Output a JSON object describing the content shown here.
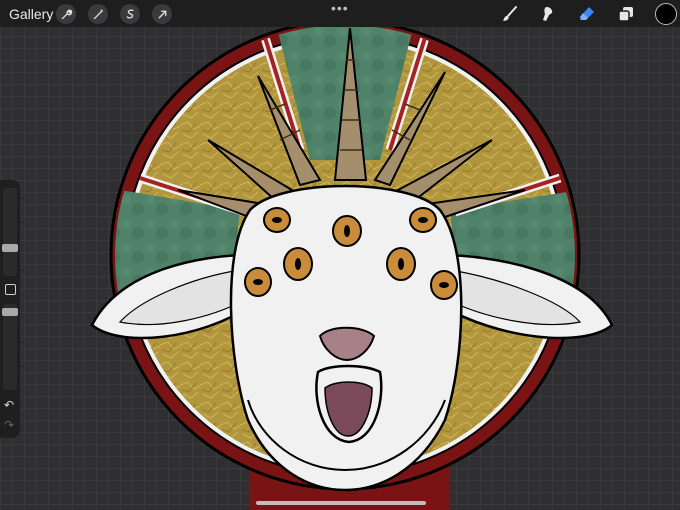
{
  "topbar": {
    "gallery_label": "Gallery",
    "left_tools": [
      "wrench-icon",
      "magic-wand-icon",
      "selection-icon",
      "transform-arrow-icon"
    ],
    "more_dots": "•••",
    "right_tools": [
      "brush-icon",
      "smudge-icon",
      "eraser-icon",
      "layers-icon"
    ],
    "active_tool": "eraser-icon",
    "active_color": "#000000",
    "accent": "#3c86f5"
  },
  "sidebar": {
    "undo_glyph": "↶",
    "redo_glyph": "↷"
  },
  "artwork": {
    "subject": "goat-head-illustration",
    "colors": {
      "gold": "#b2963d",
      "green": "#4f8268",
      "red": "#7a1414",
      "white": "#f1f1f1",
      "eye": "#c98c3a",
      "mouth": "#7b4a5a"
    }
  }
}
